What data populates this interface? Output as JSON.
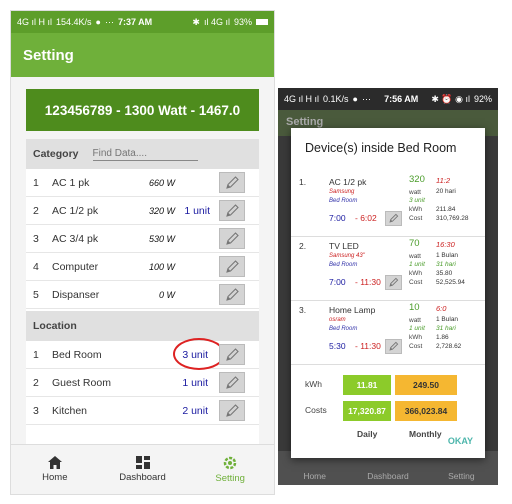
{
  "left": {
    "status": {
      "network": "4G ıl H ıl",
      "speed": "154.4K/s",
      "chat": "●",
      "dots": "⋯",
      "time": "7:37 AM",
      "bt": "✱",
      "signal": "ıl 4G ıl",
      "battery": "93%"
    },
    "appbar_title": "Setting",
    "banner": "123456789 - 1300 Watt - 1467.0",
    "category_label": "Category",
    "find_placeholder": "Find Data....",
    "devices": [
      {
        "num": "1",
        "name": "AC 1 pk",
        "watt": "660 W",
        "unit": ""
      },
      {
        "num": "2",
        "name": "AC 1/2 pk",
        "watt": "320 W",
        "unit": "1 unit"
      },
      {
        "num": "3",
        "name": "AC 3/4 pk",
        "watt": "530 W",
        "unit": ""
      },
      {
        "num": "4",
        "name": "Computer",
        "watt": "100 W",
        "unit": ""
      },
      {
        "num": "5",
        "name": "Dispanser",
        "watt": "0 W",
        "unit": ""
      }
    ],
    "location_label": "Location",
    "locations": [
      {
        "num": "1",
        "name": "Bed Room",
        "unit": "3 unit"
      },
      {
        "num": "2",
        "name": "Guest Room",
        "unit": "1 unit"
      },
      {
        "num": "3",
        "name": "Kitchen",
        "unit": "2 unit"
      }
    ],
    "nav": {
      "home": "Home",
      "dashboard": "Dashboard",
      "setting": "Setting"
    }
  },
  "right": {
    "status": {
      "network": "4G ıl H ıl",
      "speed": "0.1K/s",
      "chat": "●",
      "dots": "⋯",
      "time": "7:56 AM",
      "icons": "✱ ⏰ ◉ ıl",
      "battery": "92%"
    },
    "bg_title": "Setting",
    "dialog_title": "Device(s) inside Bed Room",
    "devices": [
      {
        "num": "1.",
        "name": "AC 1/2 pk",
        "brand": "Samsung",
        "room": "Bed Room",
        "on": "7:00",
        "off": "- 6:02",
        "watt_value": "320",
        "watt_label": "watt",
        "unit": "3 unit",
        "kwh_label": "kWh",
        "cost_label": "Cost",
        "hours": "11:2",
        "days": "20 hari",
        "kwh": "211.84",
        "cost": "310,769.28"
      },
      {
        "num": "2.",
        "name": "TV LED",
        "brand": "Samsung 43\"",
        "room": "Bed Room",
        "on": "7:00",
        "off": "- 11:30",
        "watt_value": "70",
        "watt_label": "watt",
        "unit": "1 unit",
        "kwh_label": "kWh",
        "cost_label": "Cost",
        "hours": "16:30",
        "days": "1 Bulan",
        "days2": "31 hari",
        "kwh": "35.80",
        "cost": "52,525.94"
      },
      {
        "num": "3.",
        "name": "Home Lamp",
        "brand": "osram",
        "room": "Bed Room",
        "on": "5:30",
        "off": "- 11:30",
        "watt_value": "10",
        "watt_label": "watt",
        "unit": "1 unit",
        "kwh_label": "kWh",
        "cost_label": "Cost",
        "hours": "6:0",
        "days": "1 Bulan",
        "days2": "31 hari",
        "kwh": "1.86",
        "cost": "2,728.62"
      }
    ],
    "summary": {
      "kwh_label": "kWh",
      "costs_label": "Costs",
      "daily_kwh": "11.81",
      "monthly_kwh": "249.50",
      "daily_cost": "17,320.87",
      "monthly_cost": "366,023.84",
      "daily_label": "Daily",
      "monthly_label": "Monthly"
    },
    "ok": "OKAY",
    "nav": {
      "home": "Home",
      "dashboard": "Dashboard",
      "setting": "Setting"
    }
  },
  "colors": {
    "green_dark": "#4e8c1d",
    "green": "#6fb03a",
    "lime": "#8ccb2a",
    "orange": "#f5b731",
    "blue_text": "#1a1aa0",
    "red": "#d22"
  }
}
